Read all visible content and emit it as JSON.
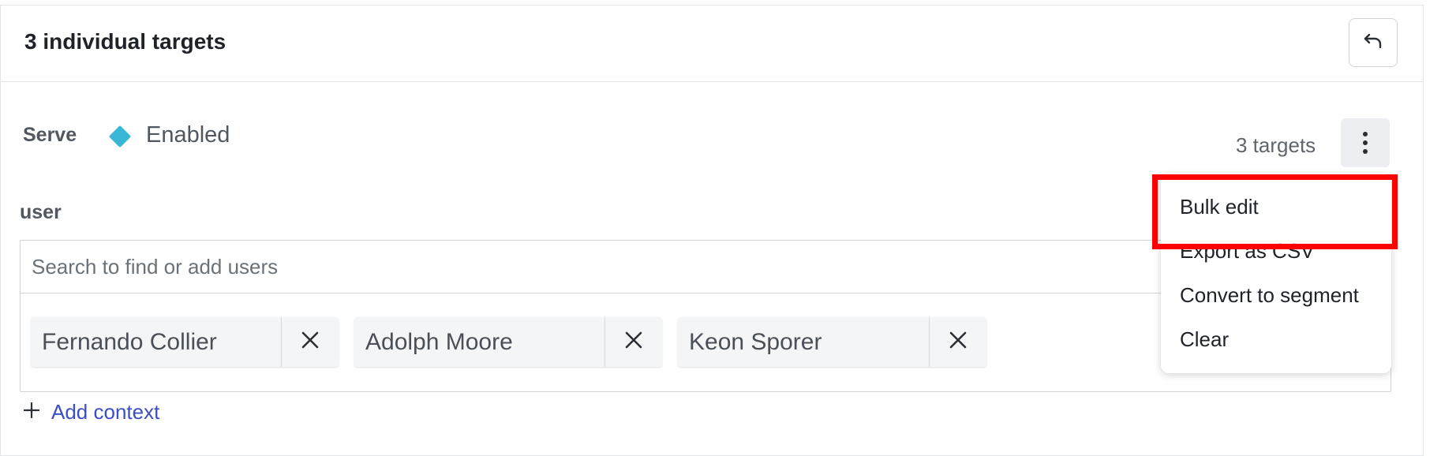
{
  "header": {
    "title": "3 individual targets"
  },
  "serve": {
    "label": "Serve",
    "value": "Enabled",
    "value_color": "#3ab6d6"
  },
  "targets": {
    "count_label": "3 targets"
  },
  "context": {
    "label": "user",
    "search_placeholder": "Search to find or add users",
    "chips": [
      {
        "label": "Fernando Collier"
      },
      {
        "label": "Adolph Moore"
      },
      {
        "label": "Keon Sporer"
      }
    ],
    "add_label": "Add context"
  },
  "menu": {
    "items": [
      {
        "label": "Bulk edit"
      },
      {
        "label": "Export as CSV"
      },
      {
        "label": "Convert to segment"
      },
      {
        "label": "Clear"
      }
    ]
  },
  "icons": {
    "undo": "undo-icon",
    "kebab": "more-vertical-icon",
    "remove": "close-icon",
    "add": "plus-icon"
  },
  "colors": {
    "link": "#3b4fc4",
    "highlight": "#ff0000"
  }
}
